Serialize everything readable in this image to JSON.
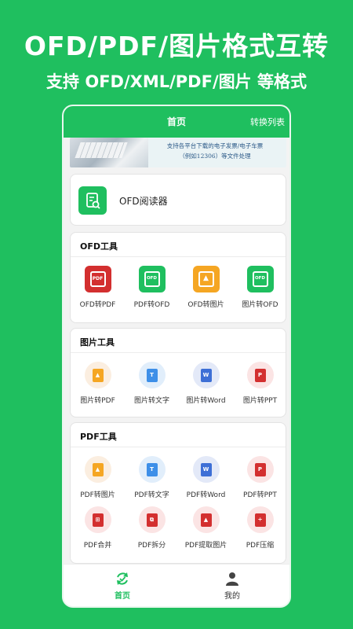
{
  "promo": {
    "headline": "OFD/PDF/图片格式互转",
    "subline": "支持 OFD/XML/PDF/图片 等格式"
  },
  "titlebar": {
    "title": "首页",
    "right_action": "转换列表"
  },
  "banner": {
    "line1": "支持各平台下载的电子发票/电子车票",
    "line2": "（例如12306）等文件处理"
  },
  "reader": {
    "label": "OFD阅读器"
  },
  "sections": {
    "ofd": {
      "title": "OFD工具",
      "tools": [
        {
          "label": "OFD转PDF",
          "icon": "pdf-file-icon",
          "color": "#d32f2f"
        },
        {
          "label": "PDF转OFD",
          "icon": "ofd-file-icon",
          "color": "#1fbf5f"
        },
        {
          "label": "OFD转图片",
          "icon": "image-stack-icon",
          "color": "#f5a623"
        },
        {
          "label": "图片转OFD",
          "icon": "ofd-file-icon",
          "color": "#1fbf5f"
        }
      ]
    },
    "image": {
      "title": "图片工具",
      "tools": [
        {
          "label": "图片转PDF",
          "icon": "image-icon",
          "color": "#f5a623",
          "glyph": "▲"
        },
        {
          "label": "图片转文字",
          "icon": "text-icon",
          "color": "#3d8fe8",
          "glyph": "T"
        },
        {
          "label": "图片转Word",
          "icon": "word-icon",
          "color": "#3d6fd6",
          "glyph": "W"
        },
        {
          "label": "图片转PPT",
          "icon": "ppt-icon",
          "color": "#d32f2f",
          "glyph": "P"
        }
      ]
    },
    "pdf": {
      "title": "PDF工具",
      "tools": [
        {
          "label": "PDF转图片",
          "icon": "image-icon",
          "color": "#f5a623",
          "glyph": "▲"
        },
        {
          "label": "PDF转文字",
          "icon": "text-icon",
          "color": "#3d8fe8",
          "glyph": "T"
        },
        {
          "label": "PDF转Word",
          "icon": "word-icon",
          "color": "#3d6fd6",
          "glyph": "W"
        },
        {
          "label": "PDF转PPT",
          "icon": "ppt-icon",
          "color": "#d32f2f",
          "glyph": "P"
        },
        {
          "label": "PDF合并",
          "icon": "merge-icon",
          "color": "#d32f2f",
          "glyph": "⊞"
        },
        {
          "label": "PDF拆分",
          "icon": "split-icon",
          "color": "#d32f2f",
          "glyph": "⧉"
        },
        {
          "label": "PDF提取图片",
          "icon": "extract-image-icon",
          "color": "#d32f2f",
          "glyph": "▲"
        },
        {
          "label": "PDF压缩",
          "icon": "compress-icon",
          "color": "#d32f2f",
          "glyph": "÷"
        }
      ]
    }
  },
  "tabbar": {
    "items": [
      {
        "label": "首页",
        "active": true,
        "color": "#1fbf5f"
      },
      {
        "label": "我的",
        "active": false,
        "color": "#333333"
      }
    ]
  },
  "colors": {
    "brand": "#1fbf5f",
    "red": "#d32f2f",
    "orange": "#f5a623",
    "blue": "#3d8fe8"
  }
}
